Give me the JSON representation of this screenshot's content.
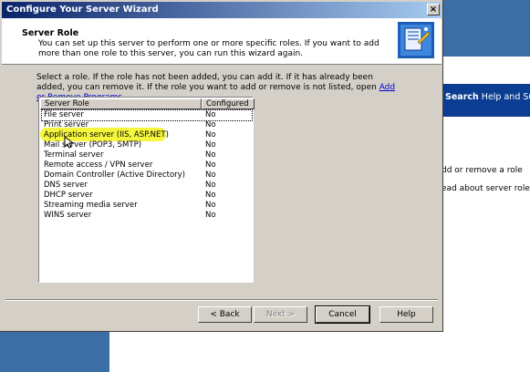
{
  "background": {
    "search_bold": "Search",
    "search_rest": " Help and Supp",
    "link_add_remove": "dd or remove a role",
    "link_read_about": "ead about server roles"
  },
  "dialog": {
    "title": "Configure Your Server Wizard",
    "close_glyph": "×",
    "header": {
      "title": "Server Role",
      "description": "You can set up this server to perform one or more specific roles. If you want to add more than one role to this server, you can run this wizard again."
    },
    "instructions_pre": "Select a role. If the role has not been added, you can add it. If it has already been added, you can remove it. If the role you want to add or remove is not listed, open ",
    "instructions_link": "Add or Remove Programs",
    "instructions_post": ".",
    "columns": [
      "Server Role",
      "Configured"
    ],
    "roles": [
      {
        "name": "File server",
        "configured": "No"
      },
      {
        "name": "Print server",
        "configured": "No"
      },
      {
        "name": "Application server (IIS, ASP.NET)",
        "configured": "No"
      },
      {
        "name": "Mail server (POP3, SMTP)",
        "configured": "No"
      },
      {
        "name": "Terminal server",
        "configured": "No"
      },
      {
        "name": "Remote access / VPN server",
        "configured": "No"
      },
      {
        "name": "Domain Controller (Active Directory)",
        "configured": "No"
      },
      {
        "name": "DNS server",
        "configured": "No"
      },
      {
        "name": "DHCP server",
        "configured": "No"
      },
      {
        "name": "Streaming media server",
        "configured": "No"
      },
      {
        "name": "WINS server",
        "configured": "No"
      }
    ],
    "buttons": {
      "back": "< Back",
      "next": "Next >",
      "cancel": "Cancel",
      "help": "Help"
    },
    "colors": {
      "title_start": "#0a246a",
      "title_end": "#a6caf0",
      "highlight": "#f5f52a"
    }
  }
}
